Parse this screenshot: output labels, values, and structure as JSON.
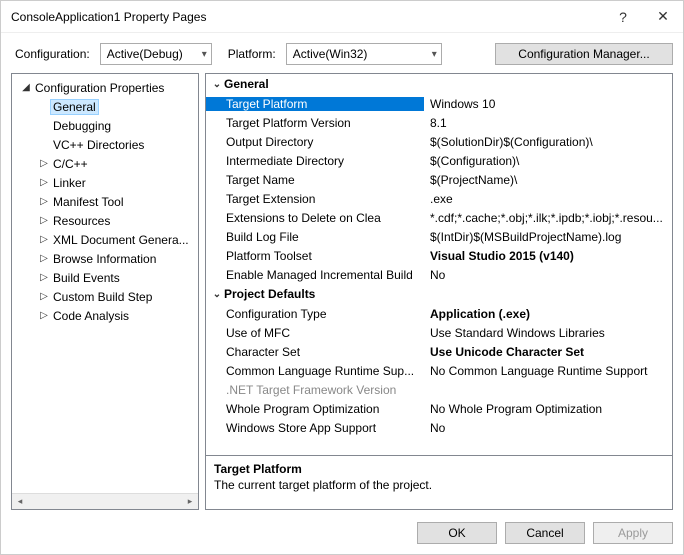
{
  "window": {
    "title": "ConsoleApplication1 Property Pages",
    "help_icon": "?",
    "close_icon": "✕"
  },
  "config_row": {
    "configuration_label": "Configuration:",
    "configuration_value": "Active(Debug)",
    "platform_label": "Platform:",
    "platform_value": "Active(Win32)",
    "config_manager_label": "Configuration Manager..."
  },
  "tree": {
    "root": "Configuration Properties",
    "items": [
      {
        "label": "General",
        "selected": true,
        "twisty": ""
      },
      {
        "label": "Debugging",
        "twisty": ""
      },
      {
        "label": "VC++ Directories",
        "twisty": ""
      },
      {
        "label": "C/C++",
        "twisty": "▷"
      },
      {
        "label": "Linker",
        "twisty": "▷"
      },
      {
        "label": "Manifest Tool",
        "twisty": "▷"
      },
      {
        "label": "Resources",
        "twisty": "▷"
      },
      {
        "label": "XML Document Genera...",
        "twisty": "▷"
      },
      {
        "label": "Browse Information",
        "twisty": "▷"
      },
      {
        "label": "Build Events",
        "twisty": "▷"
      },
      {
        "label": "Custom Build Step",
        "twisty": "▷"
      },
      {
        "label": "Code Analysis",
        "twisty": "▷"
      }
    ]
  },
  "grid": {
    "group1": "General",
    "rows1": [
      {
        "name": "Target Platform",
        "value": "Windows 10",
        "selected": true
      },
      {
        "name": "Target Platform Version",
        "value": "8.1"
      },
      {
        "name": "Output Directory",
        "value": "$(SolutionDir)$(Configuration)\\"
      },
      {
        "name": "Intermediate Directory",
        "value": "$(Configuration)\\"
      },
      {
        "name": "Target Name",
        "value": "$(ProjectName)\\"
      },
      {
        "name": "Target Extension",
        "value": ".exe"
      },
      {
        "name": "Extensions to Delete on Clea",
        "value": "*.cdf;*.cache;*.obj;*.ilk;*.ipdb;*.iobj;*.resou..."
      },
      {
        "name": "Build Log File",
        "value": "$(IntDir)$(MSBuildProjectName).log"
      },
      {
        "name": "Platform Toolset",
        "value": "Visual Studio 2015 (v140)",
        "bold": true
      },
      {
        "name": "Enable Managed Incremental Build",
        "value": "No"
      }
    ],
    "group2": "Project Defaults",
    "rows2": [
      {
        "name": "Configuration Type",
        "value": "Application (.exe)",
        "bold": true
      },
      {
        "name": "Use of MFC",
        "value": "Use Standard Windows Libraries"
      },
      {
        "name": "Character Set",
        "value": "Use Unicode Character Set",
        "bold": true
      },
      {
        "name": "Common Language Runtime Sup...",
        "value": "No Common Language Runtime Support"
      },
      {
        "name": ".NET Target Framework Version",
        "value": "",
        "dimmed": true
      },
      {
        "name": "Whole Program Optimization",
        "value": "No Whole Program Optimization"
      },
      {
        "name": "Windows Store App Support",
        "value": "No"
      }
    ]
  },
  "description": {
    "title": "Target Platform",
    "text": "The current target platform of the project."
  },
  "footer": {
    "ok": "OK",
    "cancel": "Cancel",
    "apply": "Apply"
  }
}
